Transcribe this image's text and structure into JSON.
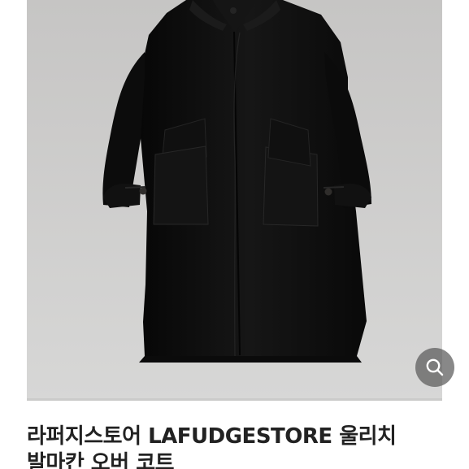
{
  "product": {
    "title": "라퍼지스토어 LAFUDGESTORE 울리치 발마칸 오버 코트"
  },
  "gallery": {
    "image_icon": "black-wool-overcoat-photo",
    "zoom_icon": "magnifier-icon"
  },
  "colors": {
    "background": "#ffffff",
    "photo_backdrop": "#cfcfce",
    "coat": "#111111",
    "zoom_button": "#5a5a5a",
    "title_text": "#222222"
  }
}
